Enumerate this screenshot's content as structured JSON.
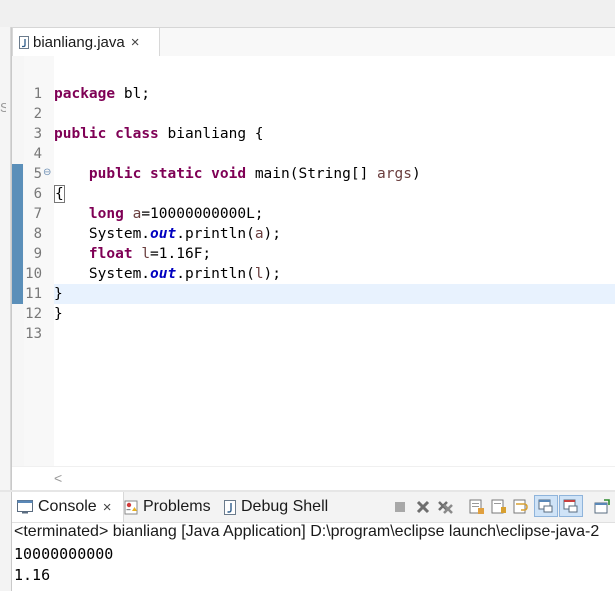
{
  "editor": {
    "tab": {
      "title": "bianliang.java",
      "close": "×"
    },
    "lines": [
      {
        "n": "1"
      },
      {
        "n": "2"
      },
      {
        "n": "3"
      },
      {
        "n": "4"
      },
      {
        "n": "5"
      },
      {
        "n": "6"
      },
      {
        "n": "7"
      },
      {
        "n": "8"
      },
      {
        "n": "9"
      },
      {
        "n": "10"
      },
      {
        "n": "11"
      },
      {
        "n": "12"
      },
      {
        "n": "13"
      }
    ],
    "code": {
      "l1_kw": "package",
      "l1_rest": " bl;",
      "l3_kw1": "public",
      "l3_kw2": "class",
      "l3_rest": " bianliang {",
      "l5_kw1": "public",
      "l5_kw2": "static",
      "l5_kw3": "void",
      "l5_rest": " main(String[] ",
      "l5_args": "args",
      "l5_end": ")",
      "l6_brace": "{",
      "l7_kw": "long",
      "l7_var": "a",
      "l7_rest": "=10000000000L;",
      "l8_a": "System.",
      "l8_out": "out",
      "l8_b": ".println(",
      "l8_var": "a",
      "l8_c": ");",
      "l9_kw": "float",
      "l9_var": "l",
      "l9_rest": "=1.16F;",
      "l10_a": "System.",
      "l10_out": "out",
      "l10_b": ".println(",
      "l10_var": "l",
      "l10_c": ");",
      "l11": "}",
      "l12": "}"
    },
    "fold_marker": "⊖",
    "scroll_left": "<"
  },
  "console": {
    "tabs": [
      {
        "label": "Console",
        "close": "×"
      },
      {
        "label": "Problems"
      },
      {
        "label": "Debug Shell"
      }
    ],
    "status": "<terminated> bianliang [Java Application] D:\\program\\eclipse launch\\eclipse-java-2",
    "output": [
      "10000000000",
      "1.16"
    ]
  },
  "colors": {
    "keyword": "#7f0055",
    "field": "#0000c0",
    "variable": "#6a3e3e",
    "current_line": "#e8f2fe"
  },
  "icons": [
    "java-file-icon",
    "console-icon",
    "problems-icon",
    "debug-shell-icon",
    "terminate-icon",
    "remove-launch-icon",
    "remove-all-icon",
    "clear-console-icon",
    "scroll-lock-icon",
    "word-wrap-icon",
    "pin-console-icon",
    "display-console-icon",
    "open-console-icon"
  ]
}
